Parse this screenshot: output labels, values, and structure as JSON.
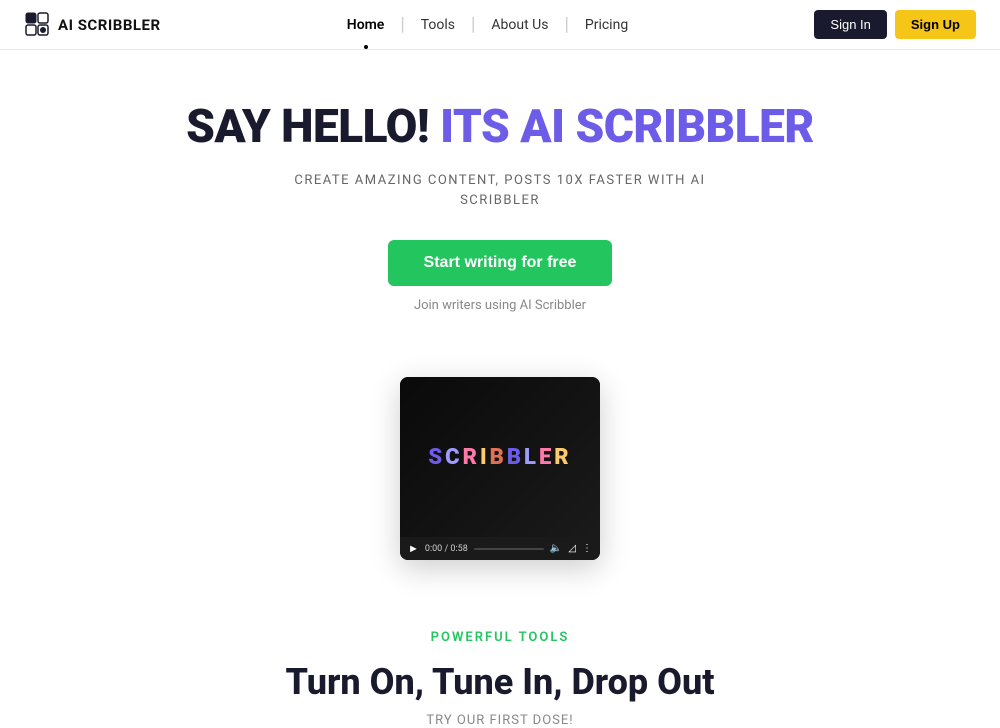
{
  "nav": {
    "logo_text": "AI SCRIBBLER",
    "logo_icon_alt": "ai-scribbler-logo",
    "links": [
      {
        "id": "home",
        "label": "Home",
        "active": true
      },
      {
        "id": "tools",
        "label": "Tools",
        "active": false
      },
      {
        "id": "about",
        "label": "About Us",
        "active": false
      },
      {
        "id": "pricing",
        "label": "Pricing",
        "active": false
      }
    ],
    "signin_label": "Sign In",
    "signup_label": "Sign Up"
  },
  "hero": {
    "title_black": "SAY HELLO!",
    "title_purple": " ITS AI SCRIBBLER",
    "subtitle_line1": "CREATE AMAZING CONTENT, POSTS 10X FASTER WITH AI",
    "subtitle_line2": "SCRIBBLER",
    "cta_label": "Start writing for free",
    "join_text": "Join writers using AI Scribbler",
    "video_time": "0:00 / 0:58",
    "video_brand": "SCRIBBLER"
  },
  "bottom": {
    "section_label": "POWERFUL TOOLS",
    "section_title": "Turn On, Tune In, Drop Out",
    "section_subtitle": "TRY OUR FIRST DOSE!"
  },
  "colors": {
    "purple": "#6c5ce7",
    "green": "#22c55e",
    "dark": "#1a1a2e",
    "yellow": "#f5c518"
  }
}
